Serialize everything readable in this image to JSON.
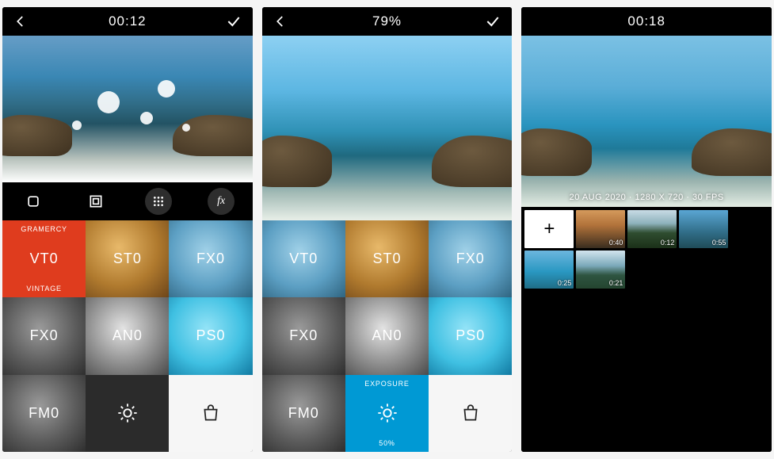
{
  "screen1": {
    "timestamp": "00:12",
    "filters": [
      {
        "code": "VT0",
        "top": "GRAMERCY",
        "bot": "VINTAGE",
        "selected": true
      },
      {
        "code": "ST0"
      },
      {
        "code": "FX0"
      },
      {
        "code": "FX0"
      },
      {
        "code": "AN0"
      },
      {
        "code": "PS0"
      },
      {
        "code": "FM0"
      },
      {
        "icon": "brightness"
      },
      {
        "icon": "shop"
      }
    ]
  },
  "screen2": {
    "progress": "79%",
    "filters": [
      {
        "code": "VT0"
      },
      {
        "code": "ST0"
      },
      {
        "code": "FX0"
      },
      {
        "code": "FX0"
      },
      {
        "code": "AN0"
      },
      {
        "code": "PS0"
      },
      {
        "code": "FM0"
      },
      {
        "icon": "brightness",
        "top": "EXPOSURE",
        "bot": "50%",
        "selected": true
      },
      {
        "icon": "shop"
      }
    ]
  },
  "screen3": {
    "timestamp": "00:18",
    "metadata": "20 AUG 2020 · 1280 X 720 · 30 FPS",
    "clips": [
      {
        "add": true,
        "label": "+"
      },
      {
        "dur": "0:40"
      },
      {
        "dur": "0:12"
      },
      {
        "dur": "0:55"
      },
      {
        "dur": "0:25"
      },
      {
        "dur": "0:21"
      }
    ]
  }
}
